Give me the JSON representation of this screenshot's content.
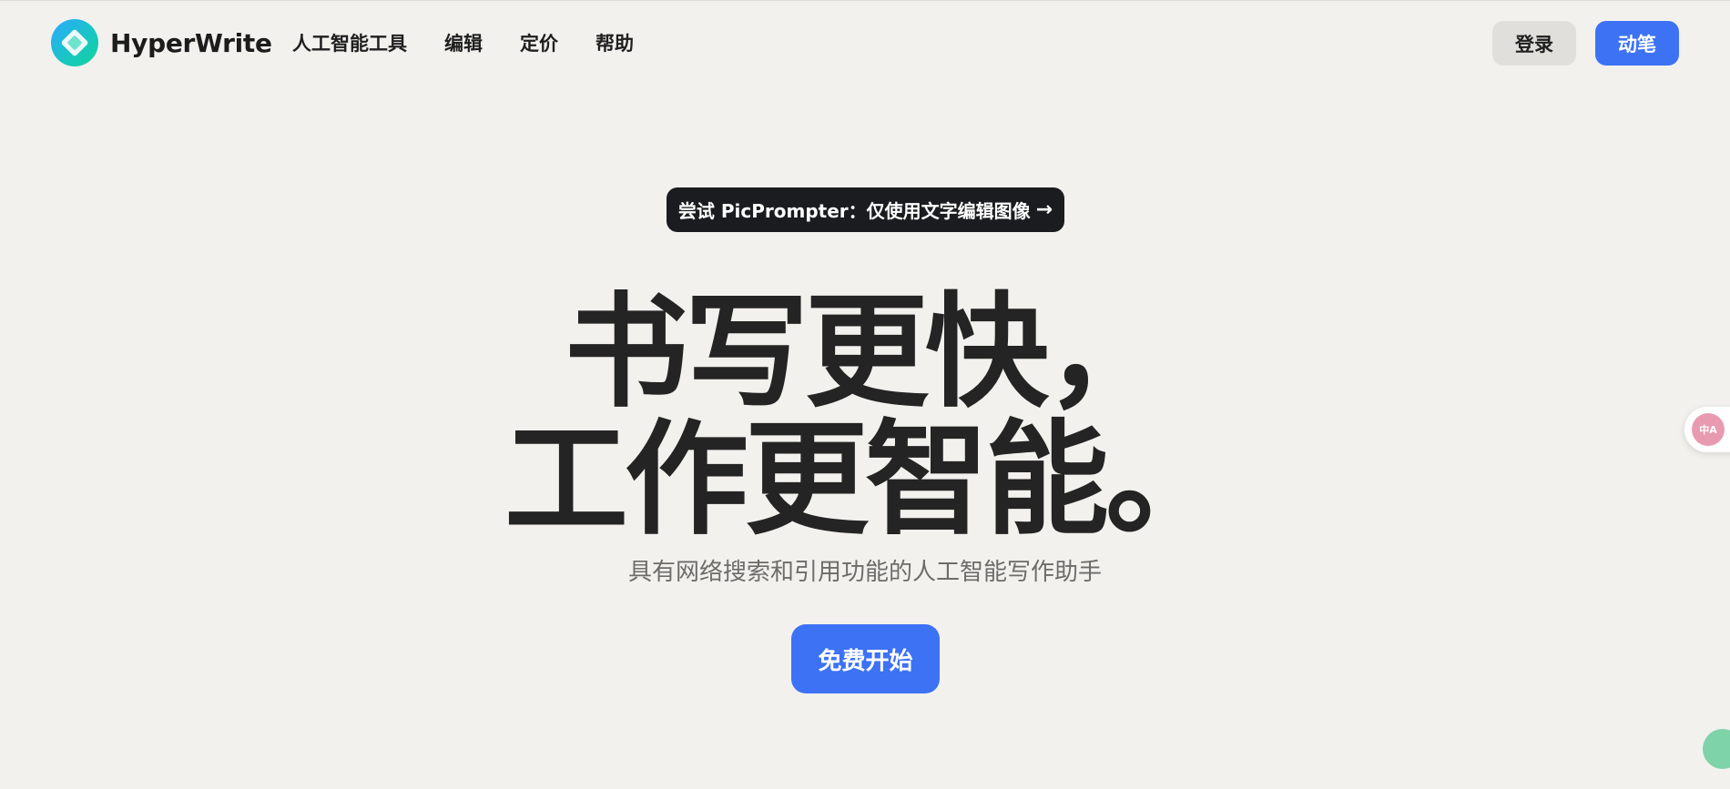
{
  "header": {
    "brand": "HyperWrite",
    "logo_icon": "hyperwrite-logo-icon",
    "nav": [
      {
        "label": "人工智能工具"
      },
      {
        "label": "编辑"
      },
      {
        "label": "定价"
      },
      {
        "label": "帮助"
      }
    ],
    "login_label": "登录",
    "signup_label": "动笔"
  },
  "announcement": {
    "label": "尝试 PicPrompter：仅使用文字编辑图像",
    "arrow": "→"
  },
  "hero": {
    "title_line1": "书写更快，",
    "title_line2": "工作更智能。",
    "subtitle": "具有网络搜索和引用功能的人工智能写作助手",
    "cta_label": "免费开始"
  },
  "widgets": {
    "translate_icon": "translate-icon",
    "translate_text": "中A",
    "chat_icon": "chat-bubble-icon"
  },
  "colors": {
    "background": "#f2f1ee",
    "accent": "#3d72f5",
    "dark": "#1b1c1f",
    "text": "#242424",
    "muted": "#6d6c69"
  }
}
